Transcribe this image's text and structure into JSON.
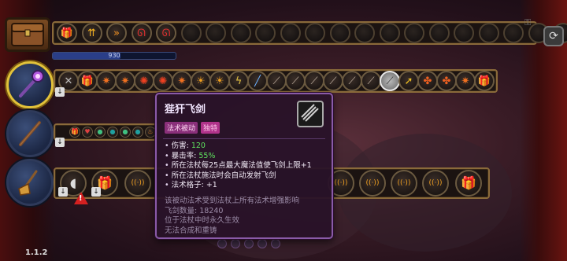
{
  "version": "1.1.2",
  "mana": {
    "value": "930",
    "fraction": 0.55
  },
  "tooltip": {
    "title": "狴犴飞剑",
    "tags": [
      "法术被动",
      "独特"
    ],
    "stats": [
      {
        "label": "伤害: ",
        "value": "120"
      },
      {
        "label": "暴击率: ",
        "value": "55%"
      },
      {
        "label": "所在法杖每25点最大魔法值使飞剑上限+1",
        "value": ""
      },
      {
        "label": "所在法杖施法时会自动发射飞剑",
        "value": ""
      },
      {
        "label": "法术格子: +1",
        "value": ""
      }
    ],
    "description": [
      "该被动法术受到法杖上所有法术增强影响",
      "飞剑数量: 18240",
      "位于法杖中时永久生效",
      "无法合成和重铸"
    ],
    "icon": "triple-sword-icon"
  },
  "colors": {
    "tooltip_border": "#8a5aa8",
    "tag_primary": "#8a2f7a",
    "tag_secondary": "#b0338a",
    "stat_value_green": "#5ee05e",
    "active_wand_ring": "#e2c23a",
    "bar_border": "#8a6a3a"
  },
  "inventory_row": {
    "filled_icons": [
      "gift-box-icon",
      "triple-arrow-up-icon",
      "double-chevron-icon",
      "red-dragon-icon",
      "red-dragon-icon"
    ],
    "empty_slots": 16
  },
  "wand1_row": {
    "icons": [
      "cross-sword-icon",
      "gift-box-icon",
      "fire-sparks-icon",
      "fire-sparks-icon",
      "flame-swirl-icon",
      "flame-swirl-icon",
      "fire-sparks-icon",
      "sun-rune-icon",
      "sun-rune-icon",
      "lightning-staff-icon",
      "blue-staff-icon",
      "sword-slash-icon",
      "sword-slash-icon",
      "sword-slash-icon",
      "sword-slash-icon",
      "sword-slash-icon",
      "sword-slash-icon",
      "selected-sword-icon",
      "arrow-up-icon",
      "tri-flame-icon",
      "tri-flame-icon",
      "fire-sparks-icon",
      "gift-box-icon"
    ]
  },
  "wand2_row": {
    "icons": [
      "gift-box-icon",
      "heart-gem-icon",
      "orb-green-icon",
      "orb-teal-icon",
      "orb-green-icon",
      "orb-teal-icon",
      "flame-icon"
    ]
  },
  "wand3_row": {
    "icons": [
      "mouse-icon",
      "gift-box-icon",
      "signal-icon",
      "signal-icon",
      "signal-icon",
      "signal-icon",
      "signal-icon",
      "gift-box-icon"
    ]
  }
}
